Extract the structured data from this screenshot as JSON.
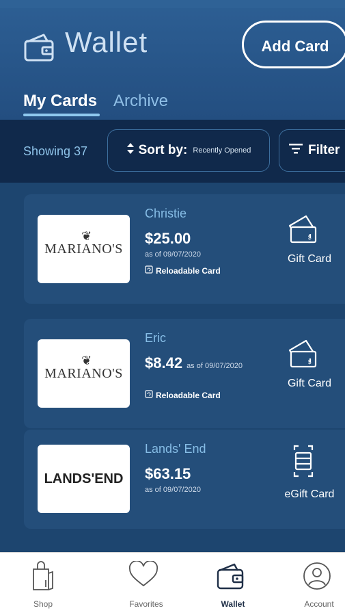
{
  "header": {
    "title": "Wallet",
    "add_card_label": "Add Card",
    "tabs": [
      {
        "label": "My Cards",
        "active": true
      },
      {
        "label": "Archive",
        "active": false
      }
    ]
  },
  "toolbar": {
    "showing_label": "Showing 37",
    "sort_label": "Sort by:",
    "sort_value": "Recently Opened",
    "filter_label": "Filter"
  },
  "cards": [
    {
      "brand": "MARIANO'S",
      "name": "Christie",
      "amount": "$25.00",
      "as_of": "as of 09/07/2020",
      "reloadable": "Reloadable Card",
      "type": "Gift Card",
      "type_icon": "gift-card-icon"
    },
    {
      "brand": "MARIANO'S",
      "name": "Eric",
      "amount": "$8.42",
      "as_of": "as of 09/07/2020",
      "reloadable": "Reloadable Card",
      "type": "Gift Card",
      "type_icon": "gift-card-icon"
    },
    {
      "brand": "LANDS'END",
      "name": "Lands' End",
      "amount": "$63.15",
      "as_of": "as of 09/07/2020",
      "type": "eGift Card",
      "type_icon": "egift-card-icon"
    }
  ],
  "bottom_nav": [
    {
      "label": "Shop",
      "icon": "shopping-bag-icon",
      "active": false
    },
    {
      "label": "Favorites",
      "icon": "heart-icon",
      "active": false
    },
    {
      "label": "Wallet",
      "icon": "wallet-icon",
      "active": true
    },
    {
      "label": "Account",
      "icon": "account-icon",
      "active": false
    }
  ],
  "colors": {
    "header_bg": "#2d5f94",
    "toolbar_bg": "#10294b",
    "list_bg": "#1d456f",
    "card_bg": "#244e7a",
    "accent_light_blue": "#8ec8ee"
  }
}
